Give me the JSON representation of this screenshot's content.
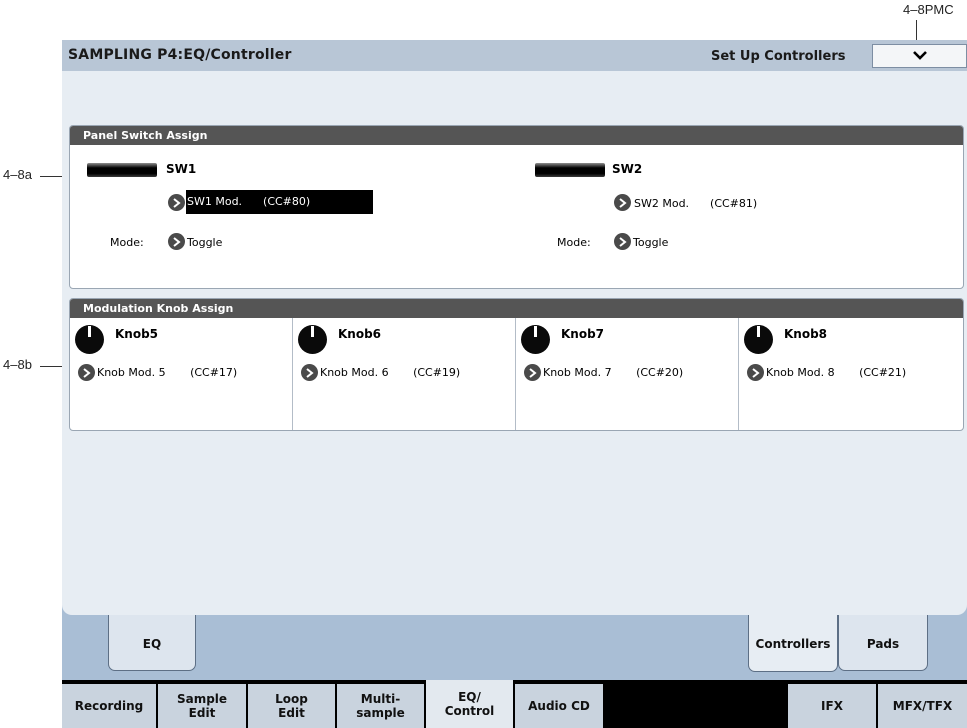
{
  "annotations": {
    "top_right": "4–8PMC",
    "left_a": "4–8a",
    "left_b": "4–8b"
  },
  "title_bar": {
    "title": "SAMPLING P4:EQ/Controller",
    "menu_label": "Set Up Controllers",
    "menu_icon": "chevron-down-icon"
  },
  "panel_switch": {
    "header": "Panel Switch Assign",
    "switches": [
      {
        "name": "SW1",
        "assign": "SW1 Mod.      (CC#80)",
        "mode_label": "Mode:",
        "mode_value": "Toggle"
      },
      {
        "name": "SW2",
        "assign": "SW2 Mod.      (CC#81)",
        "mode_label": "Mode:",
        "mode_value": "Toggle"
      }
    ]
  },
  "modulation_knob": {
    "header": "Modulation Knob Assign",
    "knobs": [
      {
        "name": "Knob5",
        "assign": "Knob Mod. 5       (CC#17)"
      },
      {
        "name": "Knob6",
        "assign": "Knob Mod. 6       (CC#19)"
      },
      {
        "name": "Knob7",
        "assign": "Knob Mod. 7       (CC#20)"
      },
      {
        "name": "Knob8",
        "assign": "Knob Mod. 8       (CC#21)"
      }
    ]
  },
  "tabs": {
    "eq": "EQ",
    "controllers": "Controllers",
    "pads": "Pads",
    "active": "Controllers"
  },
  "page_tabs": [
    "Recording",
    "Sample\nEdit",
    "Loop\nEdit",
    "Multi-\nsample",
    "EQ/\nControl",
    "Audio CD",
    "",
    "IFX",
    "MFX/TFX"
  ],
  "active_page_tab": "EQ/\nControl"
}
